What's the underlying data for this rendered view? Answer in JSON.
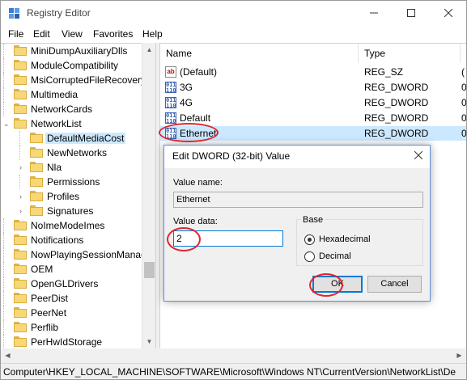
{
  "window": {
    "title": "Registry Editor"
  },
  "menu": [
    "File",
    "Edit",
    "View",
    "Favorites",
    "Help"
  ],
  "tree": {
    "items": [
      {
        "label": "MiniDumpAuxiliaryDlls",
        "depth": 0,
        "expander": ""
      },
      {
        "label": "ModuleCompatibility",
        "depth": 0,
        "expander": ""
      },
      {
        "label": "MsiCorruptedFileRecovery",
        "depth": 0,
        "expander": ""
      },
      {
        "label": "Multimedia",
        "depth": 0,
        "expander": ""
      },
      {
        "label": "NetworkCards",
        "depth": 0,
        "expander": ""
      },
      {
        "label": "NetworkList",
        "depth": 0,
        "expander": "v"
      },
      {
        "label": "DefaultMediaCost",
        "depth": 1,
        "expander": "",
        "selected": true
      },
      {
        "label": "NewNetworks",
        "depth": 1,
        "expander": ""
      },
      {
        "label": "Nla",
        "depth": 1,
        "expander": ">"
      },
      {
        "label": "Permissions",
        "depth": 1,
        "expander": ""
      },
      {
        "label": "Profiles",
        "depth": 1,
        "expander": ">"
      },
      {
        "label": "Signatures",
        "depth": 1,
        "expander": ">"
      },
      {
        "label": "NoImeModeImes",
        "depth": 0,
        "expander": ""
      },
      {
        "label": "Notifications",
        "depth": 0,
        "expander": ""
      },
      {
        "label": "NowPlayingSessionManag",
        "depth": 0,
        "expander": ""
      },
      {
        "label": "OEM",
        "depth": 0,
        "expander": ""
      },
      {
        "label": "OpenGLDrivers",
        "depth": 0,
        "expander": ""
      },
      {
        "label": "PeerDist",
        "depth": 0,
        "expander": ""
      },
      {
        "label": "PeerNet",
        "depth": 0,
        "expander": ""
      },
      {
        "label": "Perflib",
        "depth": 0,
        "expander": ""
      },
      {
        "label": "PerHwIdStorage",
        "depth": 0,
        "expander": ""
      }
    ]
  },
  "list": {
    "columns": {
      "name": "Name",
      "type": "Type",
      "data": "D"
    },
    "rows": [
      {
        "icon": "sz",
        "name": "(Default)",
        "type": "REG_SZ",
        "data": "("
      },
      {
        "icon": "dw",
        "name": "3G",
        "type": "REG_DWORD",
        "data": "0"
      },
      {
        "icon": "dw",
        "name": "4G",
        "type": "REG_DWORD",
        "data": "0"
      },
      {
        "icon": "dw",
        "name": "Default",
        "type": "REG_DWORD",
        "data": "0"
      },
      {
        "icon": "dw",
        "name": "Ethernet",
        "type": "REG_DWORD",
        "data": "0",
        "selected": true
      }
    ]
  },
  "dialog": {
    "title": "Edit DWORD (32-bit) Value",
    "value_name_label": "Value name:",
    "value_name": "Ethernet",
    "value_data_label": "Value data:",
    "value_data": "2",
    "base_label": "Base",
    "hex_label": "Hexadecimal",
    "dec_label": "Decimal",
    "base_selected": "Hexadecimal",
    "ok_label": "OK",
    "cancel_label": "Cancel"
  },
  "status": {
    "path": "Computer\\HKEY_LOCAL_MACHINE\\SOFTWARE\\Microsoft\\Windows NT\\CurrentVersion\\NetworkList\\De"
  },
  "colors": {
    "selection": "#cce8ff",
    "accent": "#0078d7",
    "annotation": "#e0262b"
  }
}
